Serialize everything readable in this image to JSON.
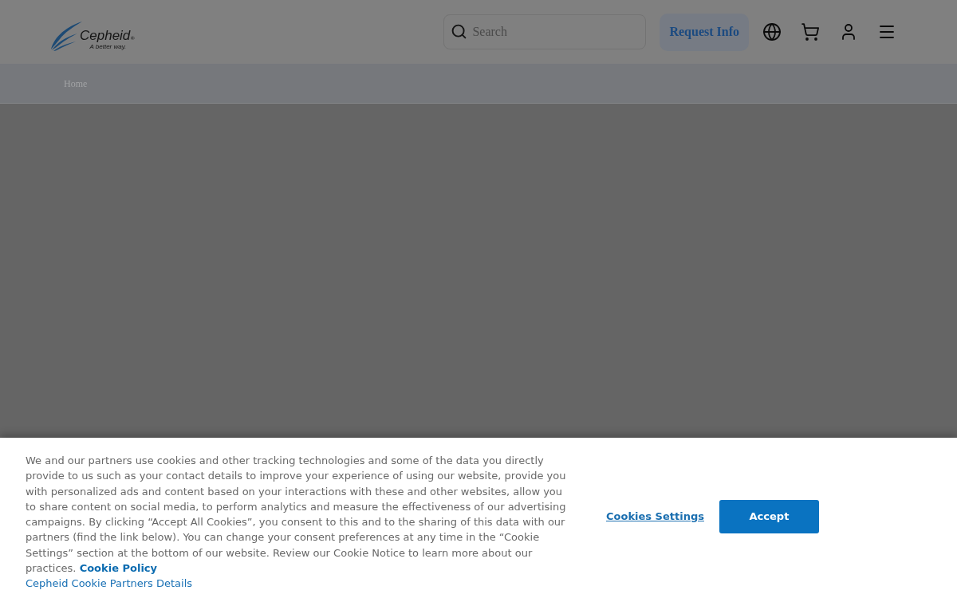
{
  "header": {
    "logo": {
      "name": "Cepheid",
      "trademark": "®",
      "tagline": "A better way."
    },
    "search": {
      "placeholder": "Search"
    },
    "request_button": "Request Info"
  },
  "breadcrumb": [
    "Home"
  ],
  "cookie_banner": {
    "text": "We and our partners use cookies and other tracking technologies and some of the data you directly provide to us such as your contact details to improve your experience of using our website, provide you with personalized ads and content based on your interactions with these and other websites, allow you to share content on social media, to perform analytics and measure the effectiveness of our advertising campaigns. By clicking “Accept All Cookies”, you consent to this and to the sharing of this data with our partners (find the link below). You can change your consent preferences at any time in the “Cookie Settings” section at the bottom of our website. Review our Cookie Notice to learn more about our practices.",
    "policy_link": "Cookie Policy",
    "partners_link": "Cepheid Cookie Partners Details",
    "settings_link": "Cookies Settings",
    "accept_button": "Accept"
  }
}
